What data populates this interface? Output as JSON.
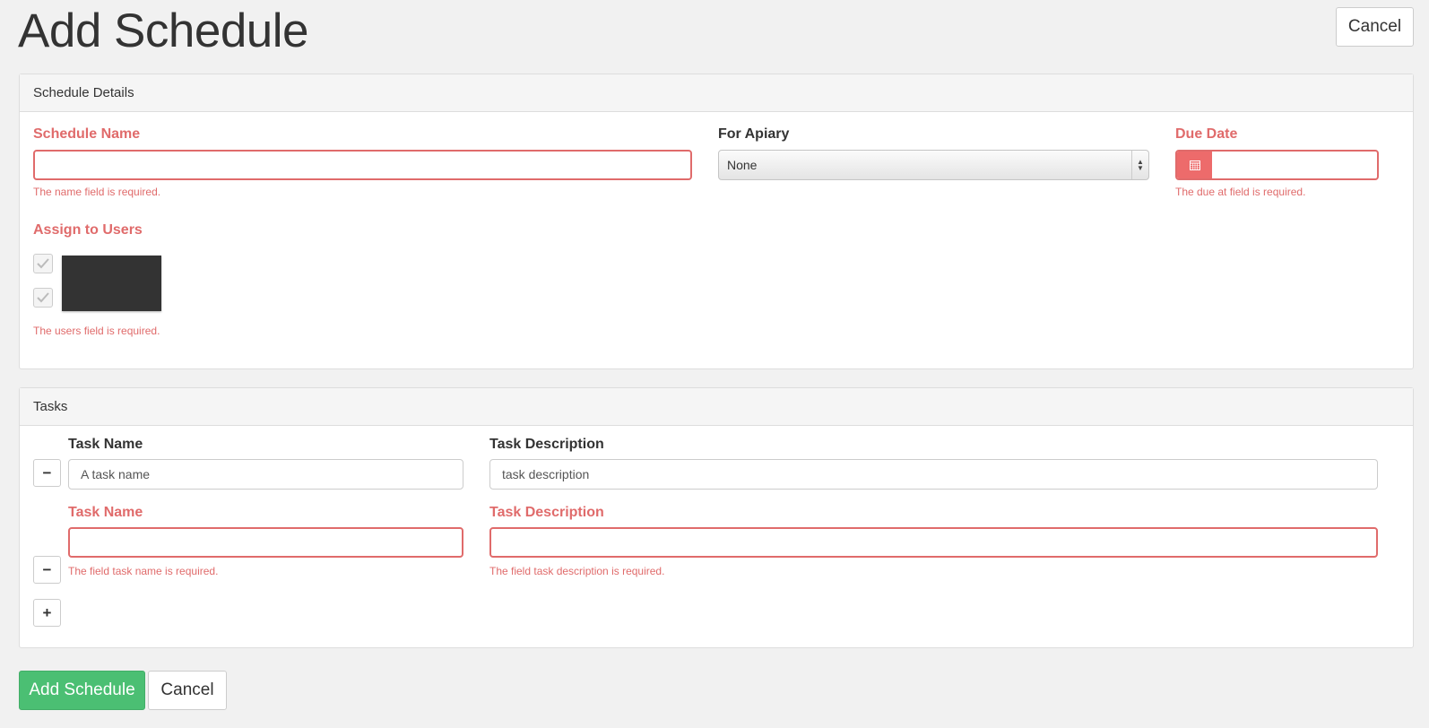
{
  "page_title": "Add Schedule",
  "header": {
    "cancel_label": "Cancel"
  },
  "schedule_details": {
    "heading": "Schedule Details",
    "schedule_name": {
      "label": "Schedule Name",
      "value": "",
      "error": "The name field is required."
    },
    "for_apiary": {
      "label": "For Apiary",
      "selected": "None"
    },
    "due_date": {
      "label": "Due Date",
      "value": "",
      "error": "The due at field is required."
    },
    "assign_users": {
      "label": "Assign to Users",
      "error": "The users field is required.",
      "users_checked": [
        true,
        true
      ]
    }
  },
  "tasks": {
    "heading": "Tasks",
    "rows": [
      {
        "name_label": "Task Name",
        "name_value": "A task name",
        "desc_label": "Task Description",
        "desc_value": "task description",
        "remove_label": "−"
      },
      {
        "name_label": "Task Name",
        "name_value": "",
        "name_error": "The field task name is required.",
        "desc_label": "Task Description",
        "desc_value": "",
        "desc_error": "The field task description is required.",
        "remove_label": "−"
      }
    ],
    "add_label": "+"
  },
  "footer": {
    "submit_label": "Add Schedule",
    "cancel_label": "Cancel"
  },
  "colors": {
    "error": "#e06b6b",
    "success": "#4bbf73",
    "addon": "#ed6b6b"
  },
  "icons": {
    "date_addon": "calendar-icon",
    "checkbox": "check-icon"
  }
}
